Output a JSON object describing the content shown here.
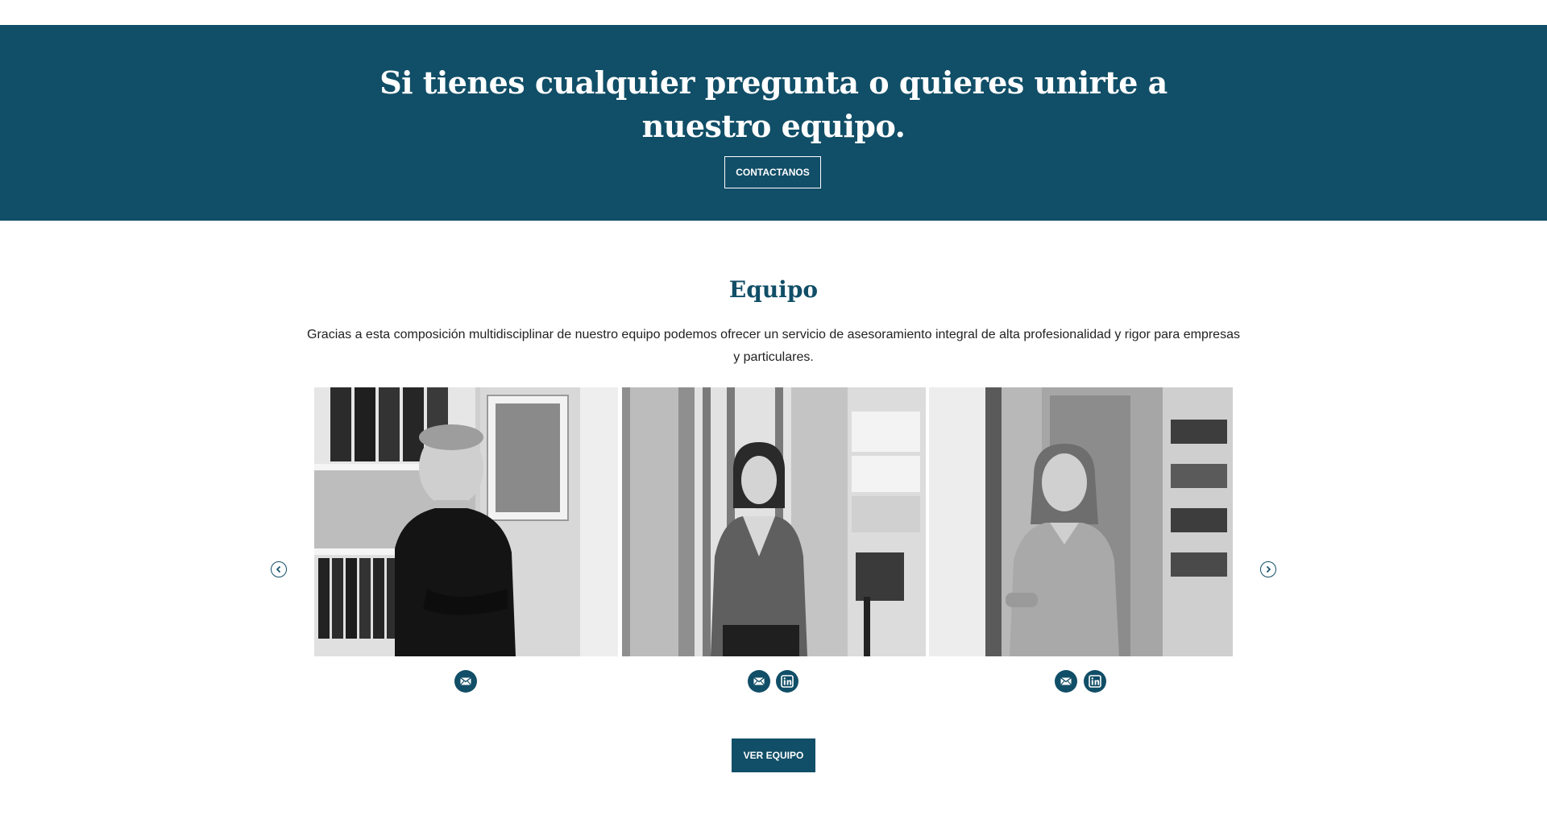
{
  "banner": {
    "title": "Si tienes cualquier pregunta o quieres unirte a nuestro equipo.",
    "button_label": "CONTACTANOS"
  },
  "team": {
    "title": "Equipo",
    "description": "Gracias a esta composición multidisciplinar de nuestro equipo podemos ofrecer un servicio de asesoramiento integral de alta profesionalidad y rigor para empresas y particulares.",
    "members": [
      {
        "photo": "man-in-dark-sweater-office-photo",
        "links": [
          "mail-icon"
        ]
      },
      {
        "photo": "woman-in-v-neck-sweater-office-photo",
        "links": [
          "mail-icon",
          "linkedin-icon"
        ]
      },
      {
        "photo": "woman-in-striped-shirt-office-photo",
        "links": [
          "mail-icon",
          "linkedin-icon"
        ]
      }
    ],
    "prev_icon": "chevron-left-icon",
    "next_icon": "chevron-right-icon",
    "button_label": "VER EQUIPO"
  },
  "colors": {
    "brand": "#114e67",
    "text": "#222222",
    "background": "#ffffff"
  }
}
